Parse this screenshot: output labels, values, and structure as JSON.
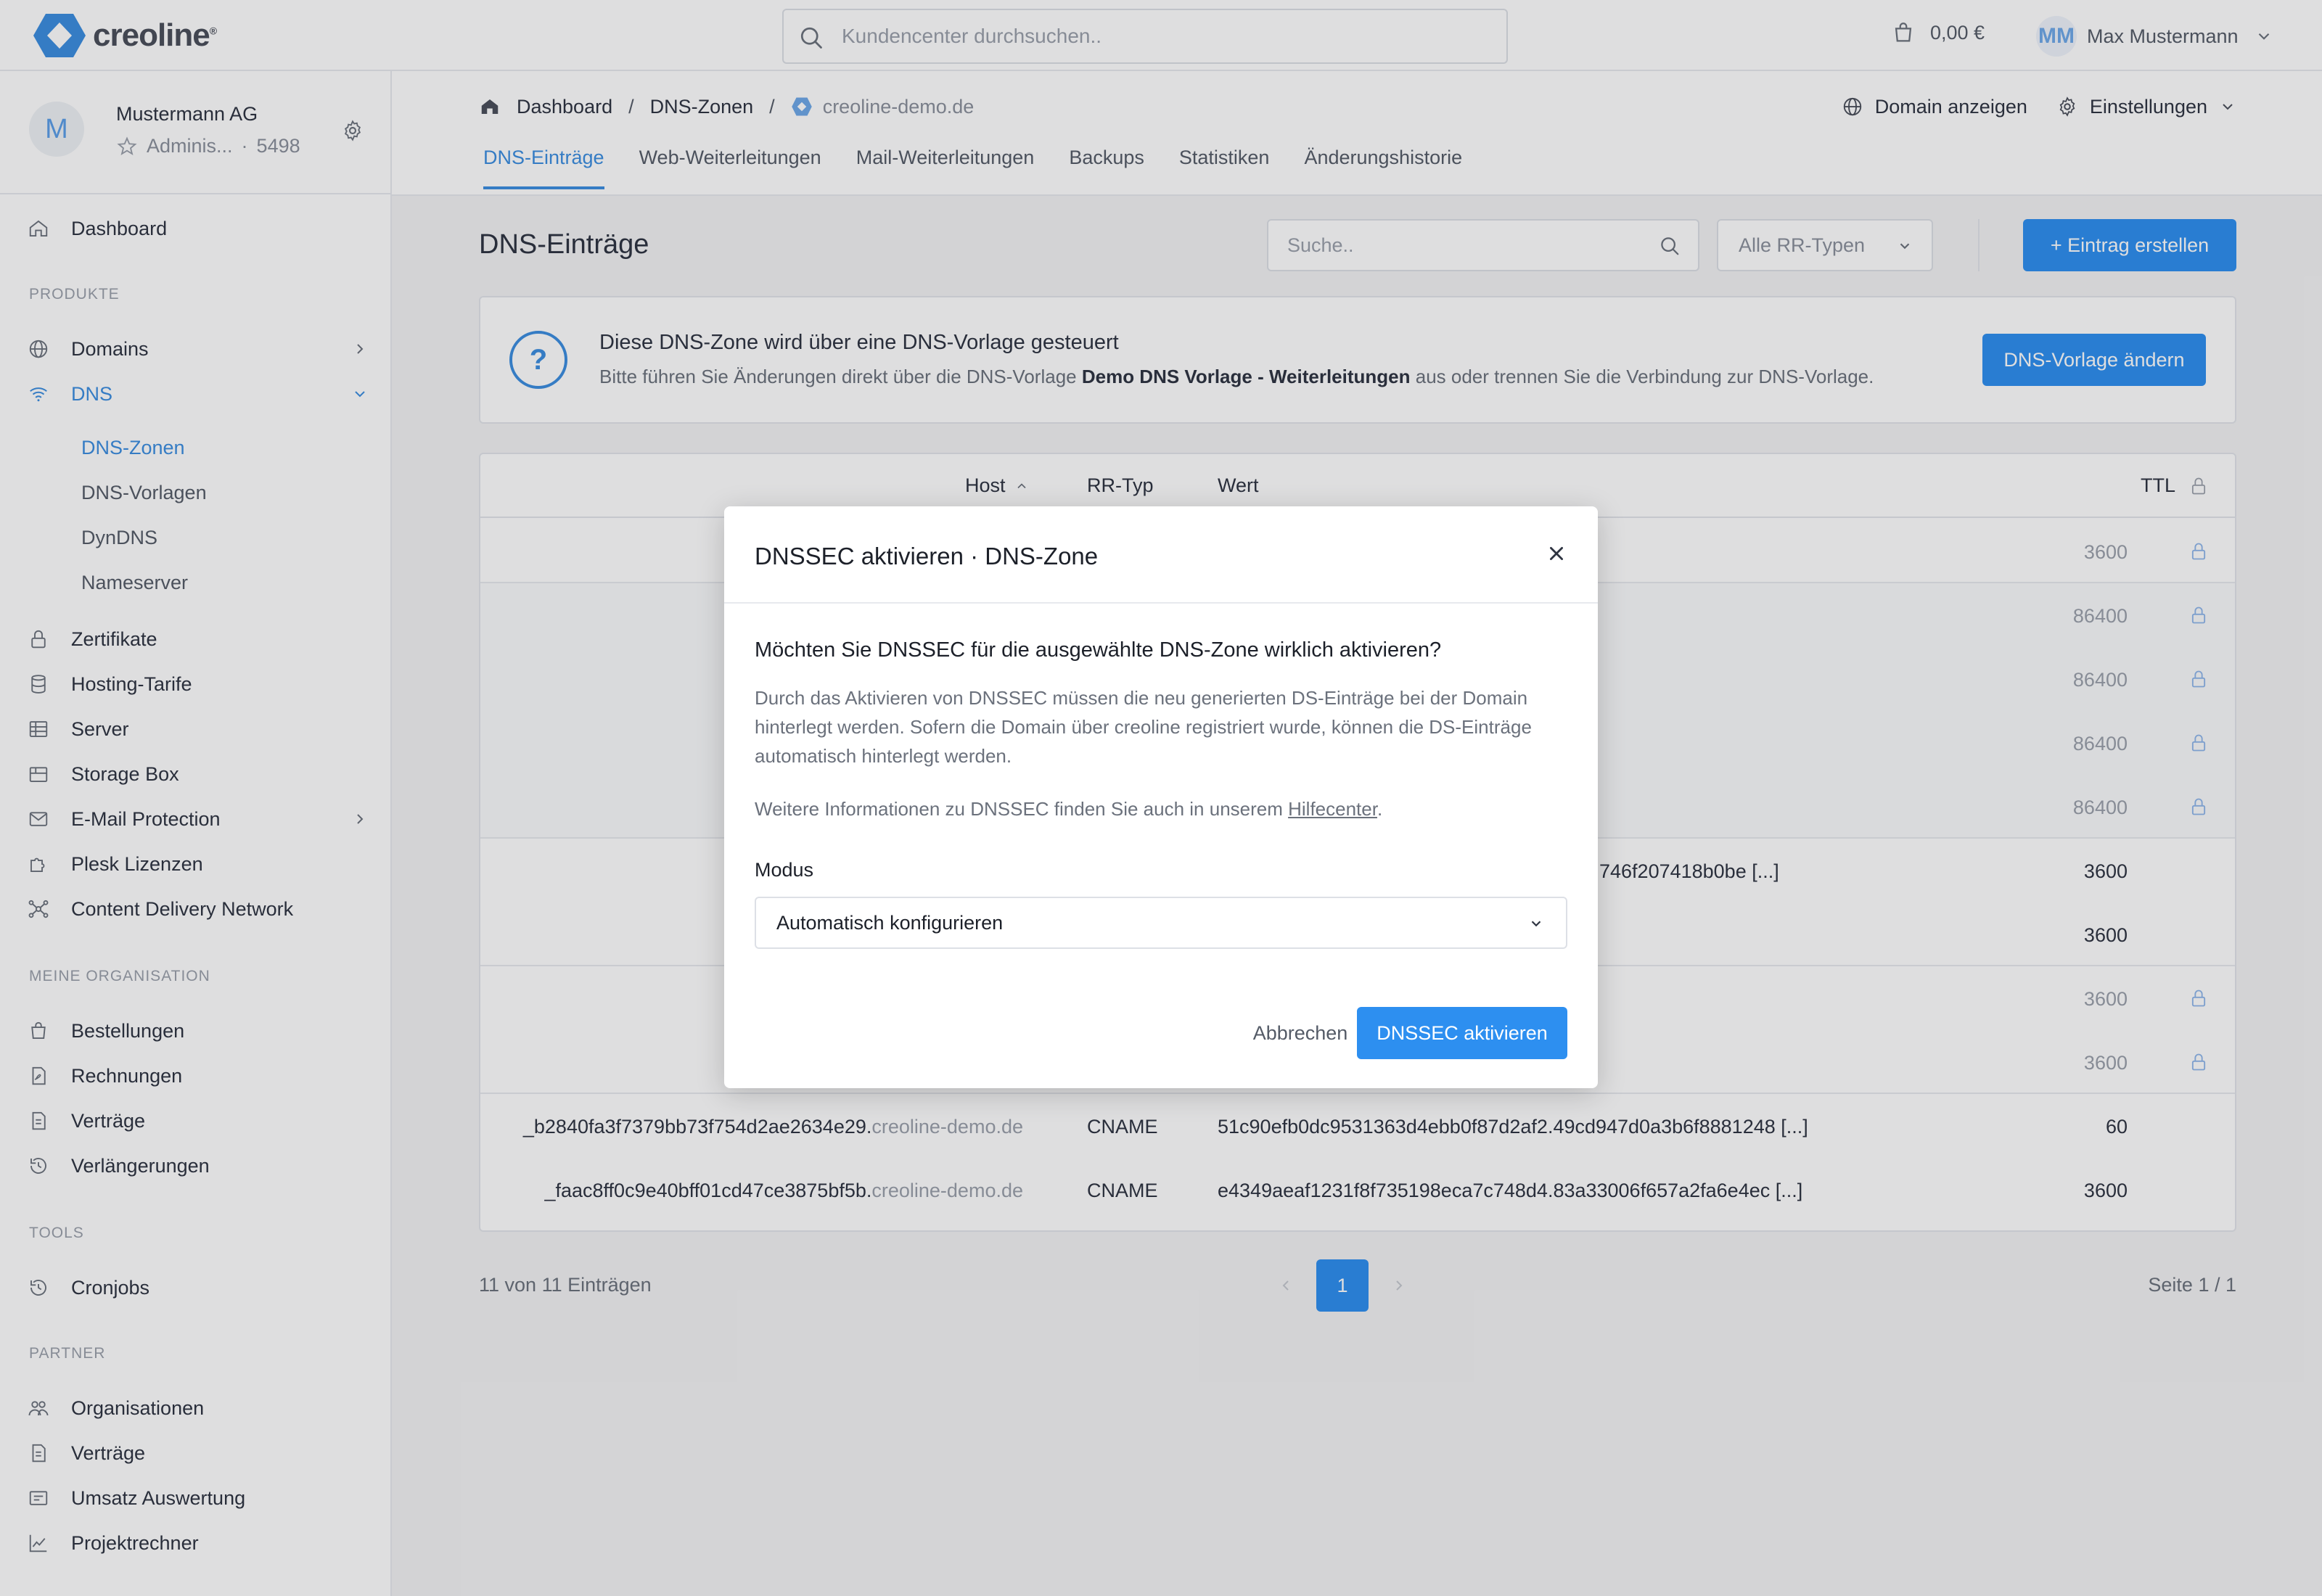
{
  "brand": {
    "name": "creoline",
    "trademark": "®"
  },
  "topbar": {
    "search_placeholder": "Kundencenter durchsuchen..",
    "cart_amount": "0,00 €",
    "user_initials": "MM",
    "user_name": "Max Mustermann"
  },
  "org": {
    "avatar": "M",
    "name": "Mustermann AG",
    "role": "Adminis...",
    "separator": "·",
    "number": "5498"
  },
  "sidebar": {
    "dashboard": "Dashboard",
    "sections": {
      "products": "PRODUKTE",
      "organisation": "MEINE ORGANISATION",
      "tools": "TOOLS",
      "partner": "PARTNER"
    },
    "products": {
      "domains": "Domains",
      "dns": "DNS",
      "dns_sub": [
        "DNS-Zonen",
        "DNS-Vorlagen",
        "DynDNS",
        "Nameserver"
      ],
      "certificates": "Zertifikate",
      "hosting": "Hosting-Tarife",
      "server": "Server",
      "storage": "Storage Box",
      "email": "E-Mail Protection",
      "plesk": "Plesk Lizenzen",
      "cdn": "Content Delivery Network"
    },
    "organisation": {
      "orders": "Bestellungen",
      "invoices": "Rechnungen",
      "contracts": "Verträge",
      "renewals": "Verlängerungen"
    },
    "tools": {
      "cronjobs": "Cronjobs"
    },
    "partner": {
      "organisations": "Organisationen",
      "contracts": "Verträge",
      "revenue": "Umsatz Auswertung",
      "calculator": "Projektrechner"
    }
  },
  "breadcrumb": {
    "home": "Dashboard",
    "sep": "/",
    "zones": "DNS-Zonen",
    "current": "creoline-demo.de"
  },
  "head_actions": {
    "show_domain": "Domain anzeigen",
    "settings": "Einstellungen"
  },
  "tabs": [
    "DNS-Einträge",
    "Web-Weiterleitungen",
    "Mail-Weiterleitungen",
    "Backups",
    "Statistiken",
    "Änderungshistorie"
  ],
  "main": {
    "title": "DNS-Einträge",
    "search_placeholder": "Suche..",
    "rr_filter": "Alle RR-Typen",
    "create_label": "+ Eintrag erstellen"
  },
  "alert": {
    "icon": "?",
    "title": "Diese DNS-Zone wird über eine DNS-Vorlage gesteuert",
    "text_before": "Bitte führen Sie Änderungen direkt über die DNS-Vorlage ",
    "template_name": "Demo DNS Vorlage - Weiterleitungen",
    "text_after": " aus oder trennen Sie die Verbindung zur DNS-Vorlage.",
    "button": "DNS-Vorlage ändern"
  },
  "table": {
    "headers": {
      "host": "Host",
      "type": "RR-Typ",
      "value": "Wert",
      "ttl": "TTL"
    },
    "rows": [
      {
        "host_prefix": "",
        "host_domain": "",
        "type": "",
        "value": "",
        "ttl": "3600",
        "locked": true,
        "muted": true
      },
      {
        "host_prefix": "",
        "host_domain": "",
        "type": "",
        "value": "",
        "ttl": "86400",
        "locked": true,
        "muted": true
      },
      {
        "host_prefix": "",
        "host_domain": "",
        "type": "",
        "value": "",
        "ttl": "86400",
        "locked": true,
        "muted": true
      },
      {
        "host_prefix": "",
        "host_domain": "",
        "type": "",
        "value": "",
        "ttl": "86400",
        "locked": true,
        "muted": true
      },
      {
        "host_prefix": "",
        "host_domain": "",
        "type": "",
        "value": "",
        "ttl": "86400",
        "locked": true,
        "muted": true
      },
      {
        "host_prefix": "",
        "host_domain": "",
        "type": "",
        "value": "746f207418b0be [...]",
        "ttl": "3600",
        "locked": false,
        "muted": false
      },
      {
        "host_prefix": "",
        "host_domain": "",
        "type": "",
        "value": "",
        "ttl": "3600",
        "locked": false,
        "muted": false
      },
      {
        "host_prefix": "",
        "host_domain": "",
        "type": "",
        "value": "",
        "ttl": "3600",
        "locked": true,
        "muted": true
      },
      {
        "host_prefix": "",
        "host_domain": "",
        "type": "",
        "value": "",
        "ttl": "3600",
        "locked": true,
        "muted": true
      },
      {
        "host_prefix": "_b2840fa3f7379bb73f754d2ae2634e29.",
        "host_domain": "creoline-demo.de",
        "type": "CNAME",
        "value": "51c90efb0dc9531363d4ebb0f87d2af2.49cd947d0a3b6f8881248 [...]",
        "ttl": "60",
        "locked": false,
        "muted": false
      },
      {
        "host_prefix": "_faac8ff0c9e40bff01cd47ce3875bf5b.",
        "host_domain": "creoline-demo.de",
        "type": "CNAME",
        "value": "e4349aeaf1231f8f735198eca7c748d4.83a33006f657a2fa6e4ec [...]",
        "ttl": "3600",
        "locked": false,
        "muted": false
      }
    ]
  },
  "footer": {
    "count": "11 von 11 Einträgen",
    "page": "1",
    "page_label": "Seite 1 / 1"
  },
  "modal": {
    "title": "DNSSEC aktivieren · DNS-Zone",
    "question": "Möchten Sie DNSSEC für die ausgewählte DNS-Zone wirklich aktivieren?",
    "paragraph": "Durch das Aktivieren von DNSSEC müssen die neu generierten DS-Einträge bei der Domain hinterlegt werden. Sofern die Domain über creoline registriert wurde, können die DS-Einträge automatisch hinterlegt werden.",
    "info_before": "Weitere Informationen zu DNSSEC finden Sie auch in unserem ",
    "info_link": "Hilfecenter",
    "info_after": ".",
    "mode_label": "Modus",
    "mode_value": "Automatisch konfigurieren",
    "cancel": "Abbrechen",
    "confirm": "DNSSEC aktivieren"
  },
  "colors": {
    "accent": "#2d8ff0",
    "link": "#3b8de0",
    "muted": "#9aa0ab"
  }
}
